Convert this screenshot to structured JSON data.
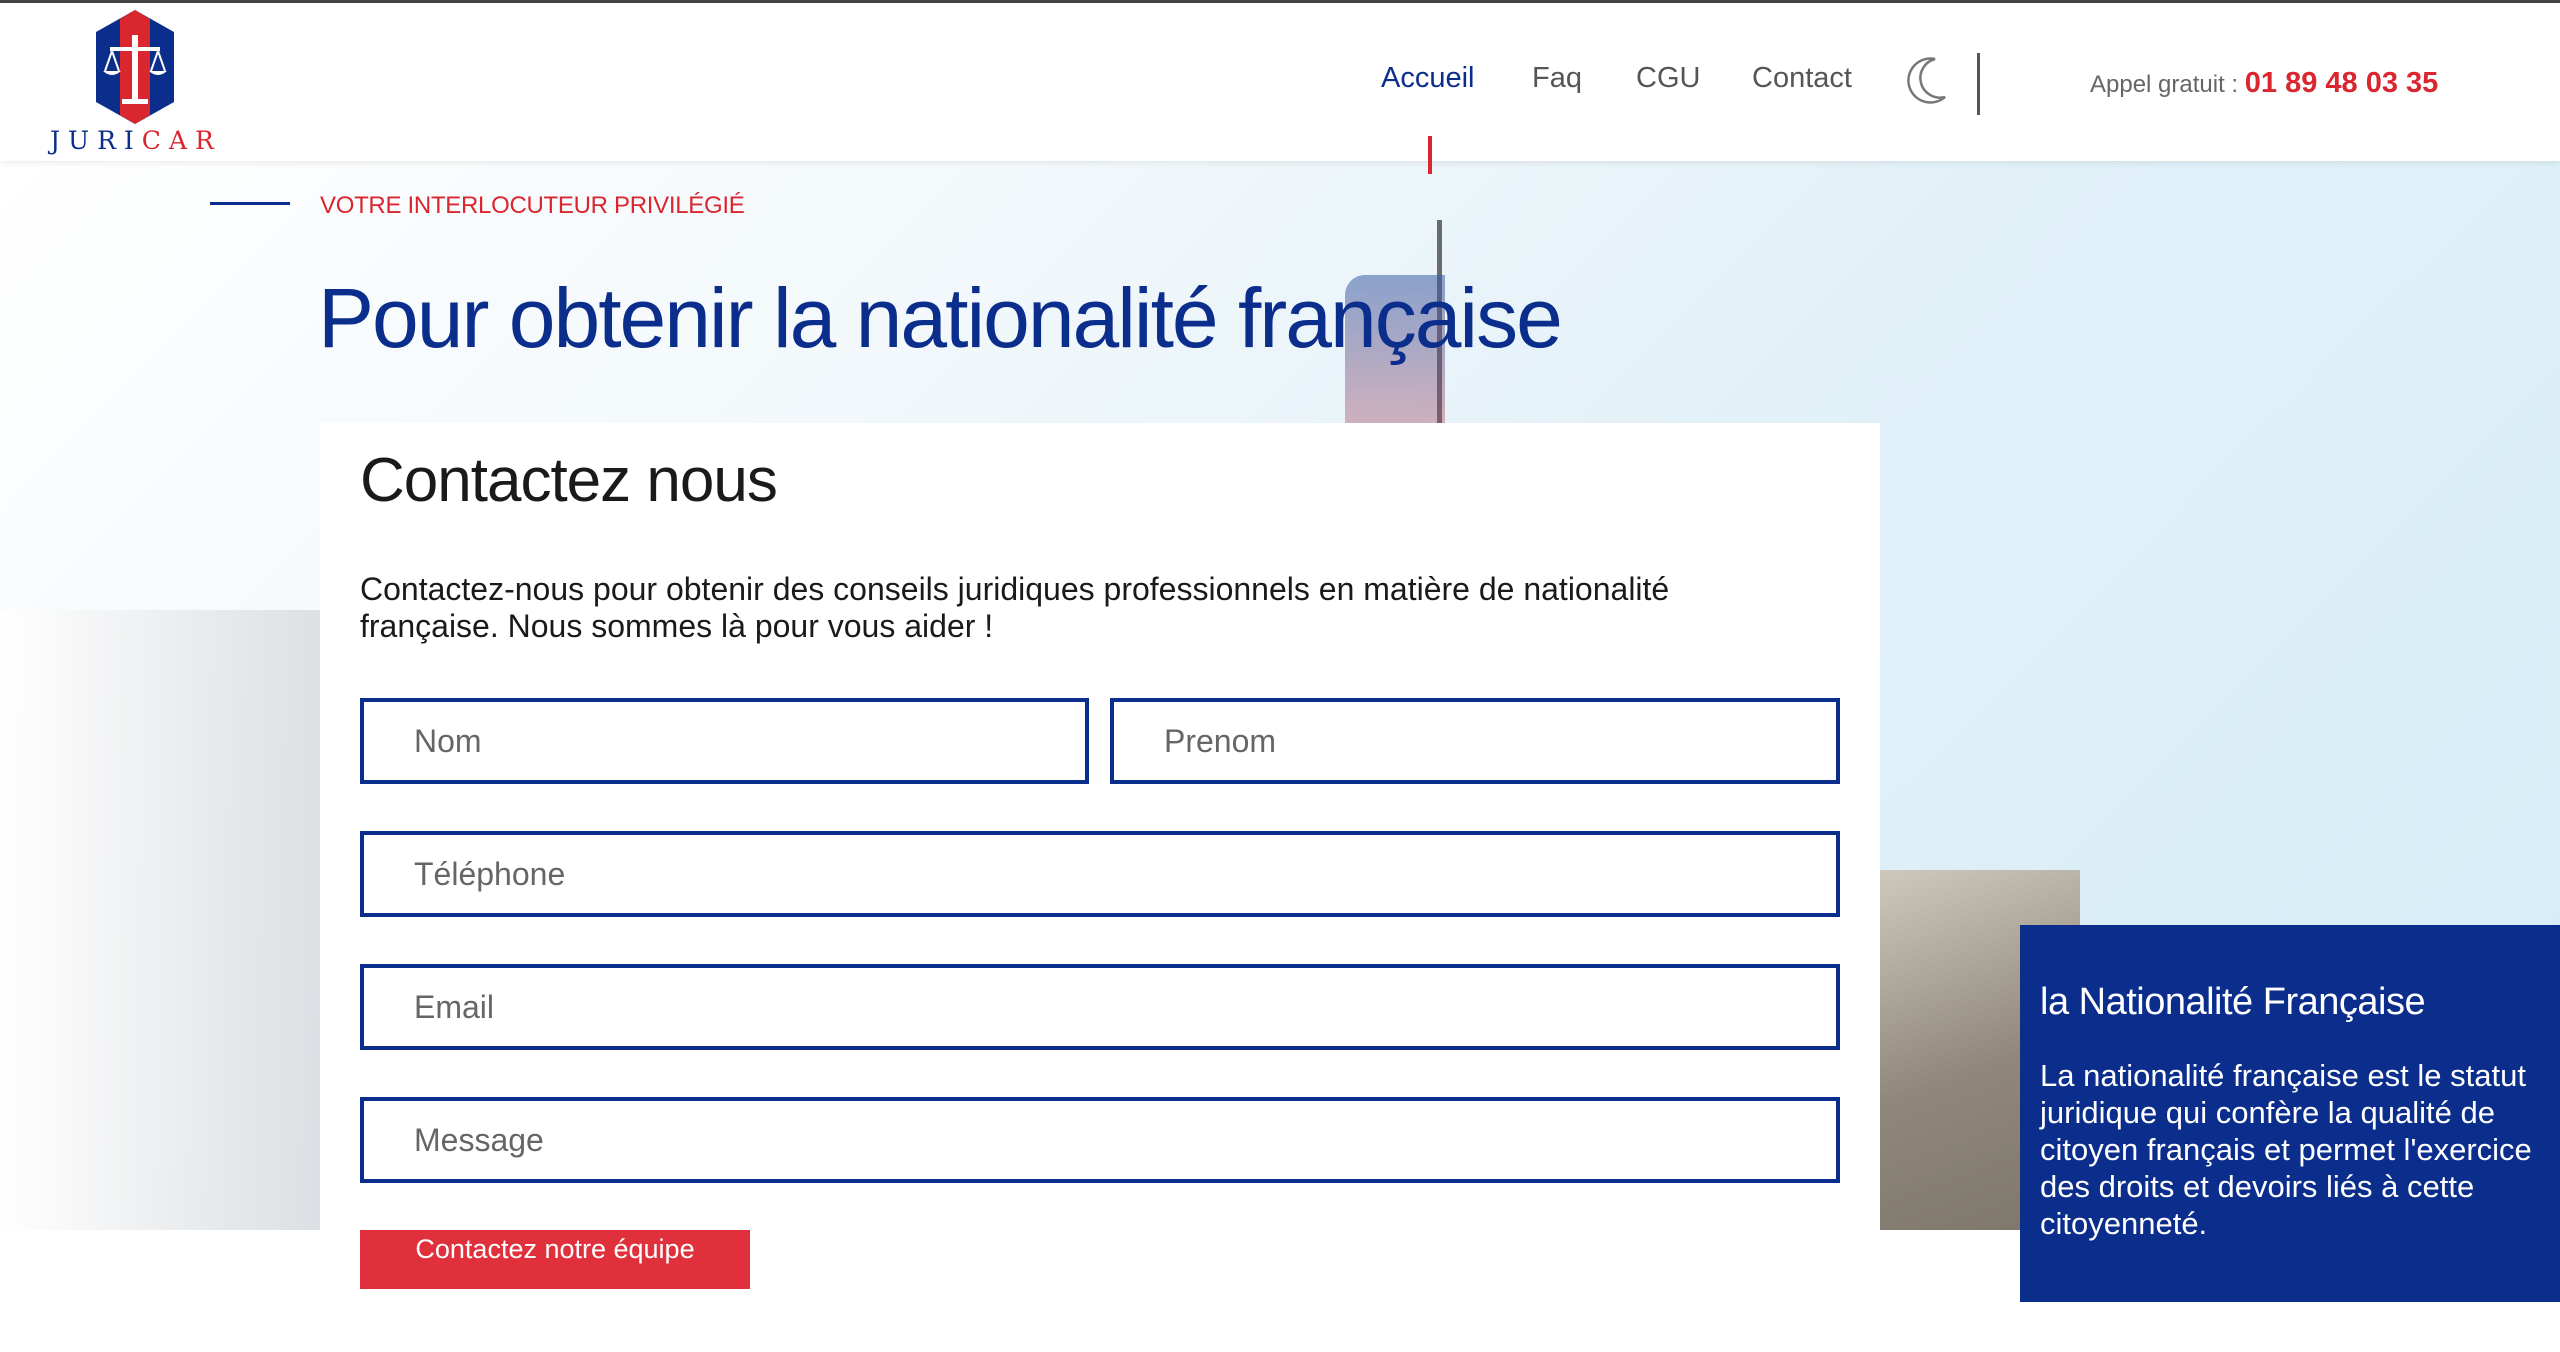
{
  "brand": {
    "logo_text_part1": "JURI",
    "logo_text_part2": "CAR",
    "primary_color": "#0b2d8c",
    "accent_color": "#d9262f"
  },
  "nav": {
    "items": [
      {
        "label": "Accueil",
        "active": true
      },
      {
        "label": "Faq",
        "active": false
      },
      {
        "label": "CGU",
        "active": false
      },
      {
        "label": "Contact",
        "active": false
      }
    ],
    "theme_toggle_icon": "moon-icon",
    "phone_label": "Appel gratuit :",
    "phone_number": "01 89 48 03 35"
  },
  "hero": {
    "eyebrow": "VOTRE INTERLOCUTEUR PRIVILÉGIÉ",
    "title": "Pour obtenir la nationalité française"
  },
  "form": {
    "title": "Contactez nous",
    "description": "Contactez-nous pour obtenir des conseils juridiques professionnels en matière de nationalité française. Nous sommes là pour vous aider !",
    "fields": {
      "nom_placeholder": "Nom",
      "prenom_placeholder": "Prenom",
      "telephone_placeholder": "Téléphone",
      "email_placeholder": "Email",
      "message_placeholder": "Message"
    },
    "submit_label": "Contactez notre équipe",
    "submit_color": "#e0303c"
  },
  "info_box": {
    "title": "la Nationalité Française",
    "text": "La nationalité française est le statut juridique qui confère la qualité de citoyen français et permet l'exercice des droits et devoirs liés à cette citoyenneté."
  }
}
